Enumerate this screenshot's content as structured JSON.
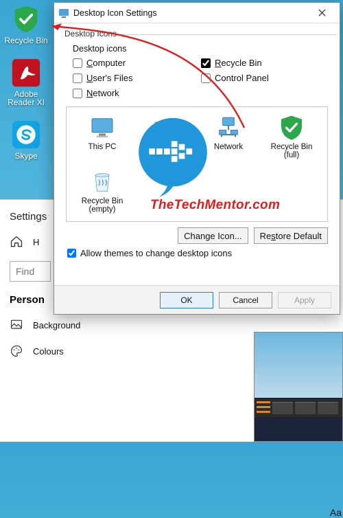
{
  "desktop": {
    "icons": [
      {
        "name": "recycle-bin-full",
        "label": "Recycle Bin"
      },
      {
        "name": "adobe-reader",
        "label": "Adobe\nReader XI"
      },
      {
        "name": "skype",
        "label": "Skype"
      }
    ]
  },
  "annotation": {
    "arrow_color": "#e11c1c"
  },
  "dialog": {
    "title": "Desktop Icon Settings",
    "group_label": "Desktop Icons",
    "section_label": "Desktop icons",
    "checks": [
      {
        "key": "computer",
        "label": "Computer",
        "underlined": "C",
        "checked": false
      },
      {
        "key": "recycle_bin",
        "label": "Recycle Bin",
        "underlined": "R",
        "checked": true
      },
      {
        "key": "users_files",
        "label": "User's Files",
        "underlined": "U",
        "checked": false
      },
      {
        "key": "control_panel",
        "label": "Control Panel",
        "underlined": "",
        "checked": false
      },
      {
        "key": "network",
        "label": "Network",
        "underlined": "N",
        "checked": false
      }
    ],
    "gallery": [
      {
        "key": "this_pc",
        "label": "This PC"
      },
      {
        "key": "user",
        "label": ""
      },
      {
        "key": "network",
        "label": "Network"
      },
      {
        "key": "recycle_full",
        "label": "Recycle Bin\n(full)"
      },
      {
        "key": "recycle_empty",
        "label": "Recycle Bin\n(empty)"
      }
    ],
    "watermark": "TheTechMentor.com",
    "watermark_color": "#e11c1c",
    "buttons": {
      "change_icon": "Change Icon...",
      "restore_default": "Restore Default"
    },
    "allow_themes": {
      "label": "Allow themes to change desktop icons",
      "checked": true
    },
    "footer": {
      "ok": "OK",
      "cancel": "Cancel",
      "apply": "Apply"
    }
  },
  "settings": {
    "title": "Settings",
    "home": "Home",
    "find_placeholder": "Find",
    "section": "Personalisation",
    "items": [
      {
        "key": "background",
        "label": "Background"
      },
      {
        "key": "colours",
        "label": "Colours"
      }
    ],
    "sample_text": "Aa"
  },
  "colors": {
    "accent_blue": "#1f97da",
    "shield_green": "#2aa84a"
  }
}
